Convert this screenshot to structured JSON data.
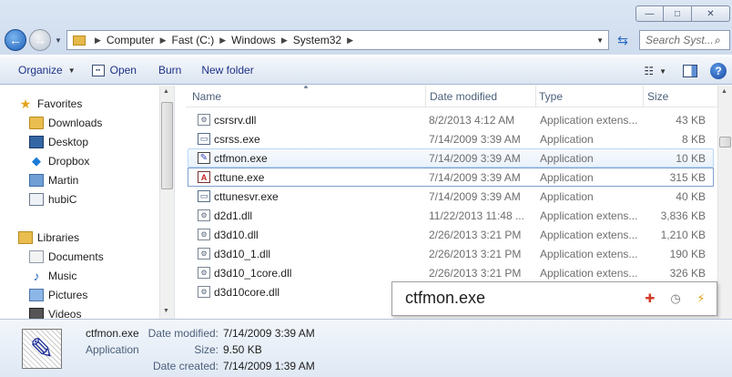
{
  "window": {
    "minimize_glyph": "—",
    "maximize_glyph": "□",
    "close_glyph": "✕"
  },
  "address": {
    "crumbs": [
      "Computer",
      "Fast (C:)",
      "Windows",
      "System32"
    ]
  },
  "search": {
    "placeholder": "Search Syst..."
  },
  "toolbar": {
    "organize_label": "Organize",
    "open_label": "Open",
    "burn_label": "Burn",
    "new_folder_label": "New folder",
    "help_label": "?"
  },
  "nav": {
    "favorites": "Favorites",
    "downloads": "Downloads",
    "desktop": "Desktop",
    "dropbox": "Dropbox",
    "martin": "Martin",
    "hubic": "hubiC",
    "libraries": "Libraries",
    "documents": "Documents",
    "music": "Music",
    "pictures": "Pictures",
    "videos": "Videos"
  },
  "columns": {
    "name": "Name",
    "date": "Date modified",
    "type": "Type",
    "size": "Size"
  },
  "files": [
    {
      "name": "csrsrv.dll",
      "date": "8/2/2013 4:12 AM",
      "type": "Application extens...",
      "size": "43 KB",
      "icon": "dll-icon"
    },
    {
      "name": "csrss.exe",
      "date": "7/14/2009 3:39 AM",
      "type": "Application",
      "size": "8 KB",
      "icon": "exe-icon"
    },
    {
      "name": "ctfmon.exe",
      "date": "7/14/2009 3:39 AM",
      "type": "Application",
      "size": "10 KB",
      "icon": "pen-icon"
    },
    {
      "name": "cttune.exe",
      "date": "7/14/2009 3:39 AM",
      "type": "Application",
      "size": "315 KB",
      "icon": "cleartype-icon"
    },
    {
      "name": "cttunesvr.exe",
      "date": "7/14/2009 3:39 AM",
      "type": "Application",
      "size": "40 KB",
      "icon": "exe-icon"
    },
    {
      "name": "d2d1.dll",
      "date": "11/22/2013 11:48 ...",
      "type": "Application extens...",
      "size": "3,836 KB",
      "icon": "dll-icon"
    },
    {
      "name": "d3d10.dll",
      "date": "2/26/2013 3:21 PM",
      "type": "Application extens...",
      "size": "1,210 KB",
      "icon": "dll-icon"
    },
    {
      "name": "d3d10_1.dll",
      "date": "2/26/2013 3:21 PM",
      "type": "Application extens...",
      "size": "190 KB",
      "icon": "dll-icon"
    },
    {
      "name": "d3d10_1core.dll",
      "date": "2/26/2013 3:21 PM",
      "type": "Application extens...",
      "size": "326 KB",
      "icon": "dll-icon"
    },
    {
      "name": "d3d10core.dll",
      "date": "",
      "type": "",
      "size": "",
      "icon": "dll-icon"
    }
  ],
  "tooltip": {
    "title": "ctfmon.exe"
  },
  "details": {
    "name": "ctfmon.exe",
    "type": "Application",
    "modified_label": "Date modified:",
    "modified_value": "7/14/2009 3:39 AM",
    "size_label": "Size:",
    "size_value": "9.50 KB",
    "created_label": "Date created:",
    "created_value": "7/14/2009 1:39 AM"
  }
}
